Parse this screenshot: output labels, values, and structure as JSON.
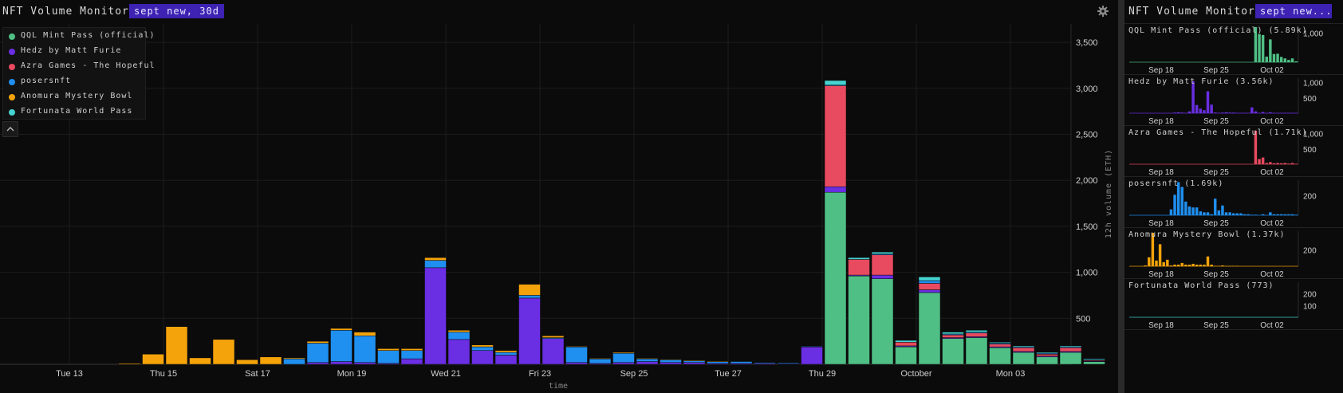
{
  "header": {
    "title": "NFT Volume Monitor",
    "preset": "sept new, 30d"
  },
  "side_header": {
    "title": "NFT Volume Monitor",
    "preset": "sept new..."
  },
  "colors": {
    "qql": "#4fbf85",
    "hedz": "#6a2ee3",
    "azra": "#e84a5f",
    "posers": "#1f8ff0",
    "anomura": "#f5a30a",
    "fortunata": "#45d4d2"
  },
  "chart_data": {
    "type": "bar",
    "stacked": true,
    "xlabel": "time",
    "ylabel": "12h volume (ETH)",
    "ylim": [
      0,
      3700
    ],
    "yticks": [
      500,
      1000,
      1500,
      2000,
      2500,
      3000,
      3500
    ],
    "x_tick_labels": [
      "Tue 13",
      "Thu 15",
      "Sat 17",
      "Mon 19",
      "Wed 21",
      "Fri 23",
      "Sep 25",
      "Tue 27",
      "Thu 29",
      "October",
      "Mon 03"
    ],
    "legend_position": "top-left",
    "grid": true,
    "series": [
      {
        "name": "QQL Mint Pass (official)",
        "color": "#4fbf85",
        "values": [
          0,
          0,
          0,
          0,
          0,
          0,
          0,
          0,
          0,
          0,
          0,
          0,
          0,
          0,
          0,
          0,
          0,
          0,
          0,
          0,
          0,
          0,
          0,
          0,
          0,
          0,
          0,
          0,
          0,
          0,
          0,
          0,
          0,
          0,
          1870,
          960,
          930,
          190,
          780,
          280,
          290,
          180,
          130,
          80,
          130,
          30
        ]
      },
      {
        "name": "Hedz by Matt Furie",
        "color": "#6a2ee3",
        "values": [
          0,
          0,
          0,
          0,
          0,
          0,
          0,
          0,
          0,
          0,
          0,
          0,
          20,
          30,
          20,
          10,
          60,
          1050,
          270,
          150,
          100,
          720,
          280,
          20,
          10,
          20,
          30,
          20,
          20,
          10,
          10,
          10,
          5,
          190,
          60,
          10,
          40,
          10,
          30,
          10,
          10,
          10,
          10,
          10,
          10,
          5
        ]
      },
      {
        "name": "Azra Games - The Hopeful",
        "color": "#e84a5f",
        "values": [
          0,
          0,
          0,
          0,
          0,
          0,
          0,
          0,
          0,
          0,
          0,
          0,
          0,
          0,
          0,
          0,
          0,
          0,
          0,
          0,
          0,
          0,
          0,
          0,
          0,
          0,
          0,
          0,
          0,
          0,
          0,
          0,
          0,
          0,
          1100,
          170,
          220,
          40,
          70,
          30,
          40,
          30,
          40,
          20,
          40,
          10
        ]
      },
      {
        "name": "posersnft",
        "color": "#1f8ff0",
        "values": [
          0,
          0,
          0,
          0,
          0,
          0,
          0,
          0,
          0,
          0,
          0,
          60,
          210,
          340,
          290,
          140,
          90,
          80,
          80,
          40,
          30,
          30,
          10,
          170,
          50,
          100,
          30,
          30,
          20,
          20,
          20,
          10,
          10,
          5,
          5,
          0,
          10,
          0,
          30,
          10,
          10,
          10,
          10,
          10,
          10,
          5
        ]
      },
      {
        "name": "Anomura Mystery Bowl",
        "color": "#f5a30a",
        "values": [
          0,
          0,
          0,
          0,
          10,
          110,
          410,
          70,
          270,
          50,
          80,
          10,
          20,
          20,
          40,
          20,
          20,
          30,
          20,
          20,
          20,
          120,
          20,
          5,
          5,
          10,
          5,
          5,
          5,
          5,
          0,
          0,
          0,
          0,
          0,
          0,
          0,
          0,
          0,
          0,
          0,
          0,
          0,
          0,
          0,
          0
        ]
      },
      {
        "name": "Fortunata World Pass",
        "color": "#45d4d2",
        "values": [
          0,
          0,
          0,
          0,
          0,
          0,
          0,
          0,
          0,
          0,
          0,
          0,
          0,
          0,
          0,
          0,
          0,
          0,
          0,
          0,
          0,
          0,
          0,
          0,
          0,
          0,
          0,
          0,
          0,
          0,
          0,
          0,
          0,
          0,
          50,
          20,
          20,
          20,
          40,
          20,
          20,
          10,
          10,
          10,
          10,
          10
        ]
      }
    ]
  },
  "mini_charts": [
    {
      "title": "QQL Mint Pass (official) (5.89k)",
      "color": "#4fbf85",
      "x_labels": [
        "Sep 18",
        "Sep 25",
        "Oct 02"
      ],
      "y_ticks": [
        1000
      ],
      "ymax": 1200,
      "values": [
        0,
        0,
        0,
        0,
        0,
        0,
        0,
        0,
        0,
        0,
        0,
        0,
        0,
        0,
        0,
        0,
        0,
        0,
        0,
        0,
        0,
        0,
        0,
        0,
        0,
        0,
        0,
        0,
        0,
        0,
        0,
        0,
        0,
        0,
        1870,
        960,
        930,
        190,
        780,
        280,
        290,
        180,
        130,
        80,
        130,
        30
      ]
    },
    {
      "title": "Hedz by Matt Furie (3.56k)",
      "color": "#6a2ee3",
      "x_labels": [
        "Sep 18",
        "Sep 25",
        "Oct 02"
      ],
      "y_ticks": [
        500,
        1000
      ],
      "ymax": 1150,
      "values": [
        0,
        0,
        0,
        0,
        0,
        0,
        0,
        0,
        0,
        0,
        0,
        0,
        20,
        30,
        20,
        10,
        60,
        1050,
        270,
        150,
        100,
        720,
        280,
        20,
        10,
        20,
        30,
        20,
        20,
        10,
        10,
        10,
        5,
        190,
        60,
        10,
        40,
        10,
        30,
        10,
        10,
        10,
        10,
        10,
        10,
        5
      ]
    },
    {
      "title": "Azra Games - The Hopeful (1.71k)",
      "color": "#e84a5f",
      "x_labels": [
        "Sep 18",
        "Sep 25",
        "Oct 02"
      ],
      "y_ticks": [
        500,
        1000
      ],
      "ymax": 1150,
      "values": [
        0,
        0,
        0,
        0,
        0,
        0,
        0,
        0,
        0,
        0,
        0,
        0,
        0,
        0,
        0,
        0,
        0,
        0,
        0,
        0,
        0,
        0,
        0,
        0,
        0,
        0,
        0,
        0,
        0,
        0,
        0,
        0,
        0,
        0,
        1100,
        170,
        220,
        40,
        70,
        30,
        40,
        30,
        40,
        20,
        40,
        10
      ]
    },
    {
      "title": "posersnft (1.69k)",
      "color": "#1f8ff0",
      "x_labels": [
        "Sep 18",
        "Sep 25",
        "Oct 02"
      ],
      "y_ticks": [
        200
      ],
      "ymax": 360,
      "values": [
        0,
        0,
        0,
        0,
        0,
        0,
        0,
        0,
        0,
        0,
        0,
        60,
        210,
        340,
        290,
        140,
        90,
        80,
        80,
        40,
        30,
        30,
        10,
        170,
        50,
        100,
        30,
        30,
        20,
        20,
        20,
        10,
        10,
        5,
        5,
        0,
        10,
        0,
        30,
        10,
        10,
        10,
        10,
        10,
        10,
        5
      ]
    },
    {
      "title": "Anomura Mystery Bowl (1.37k)",
      "color": "#f5a30a",
      "x_labels": [
        "Sep 18",
        "Sep 25",
        "Oct 02"
      ],
      "y_ticks": [
        200
      ],
      "ymax": 430,
      "values": [
        0,
        0,
        0,
        0,
        10,
        110,
        410,
        70,
        270,
        50,
        80,
        10,
        20,
        20,
        40,
        20,
        20,
        30,
        20,
        20,
        20,
        120,
        20,
        5,
        5,
        10,
        5,
        5,
        5,
        5,
        0,
        0,
        0,
        0,
        0,
        0,
        0,
        0,
        0,
        0,
        0,
        0,
        0,
        0,
        0,
        0
      ]
    },
    {
      "title": "Fortunata World Pass (773)",
      "color": "#45d4d2",
      "x_labels": [
        "Sep 18",
        "Sep 25",
        "Oct 02"
      ],
      "y_ticks": [
        100,
        200
      ],
      "ymax": 300,
      "values": [
        0,
        0,
        0,
        0,
        0,
        0,
        0,
        0,
        0,
        0,
        0,
        0,
        0,
        0,
        0,
        0,
        0,
        0,
        0,
        0,
        0,
        0,
        0,
        0,
        0,
        0,
        0,
        0,
        0,
        0,
        0,
        0,
        0,
        0,
        0,
        0,
        0,
        0,
        0,
        0,
        0,
        0,
        0,
        0,
        0,
        0
      ]
    }
  ]
}
